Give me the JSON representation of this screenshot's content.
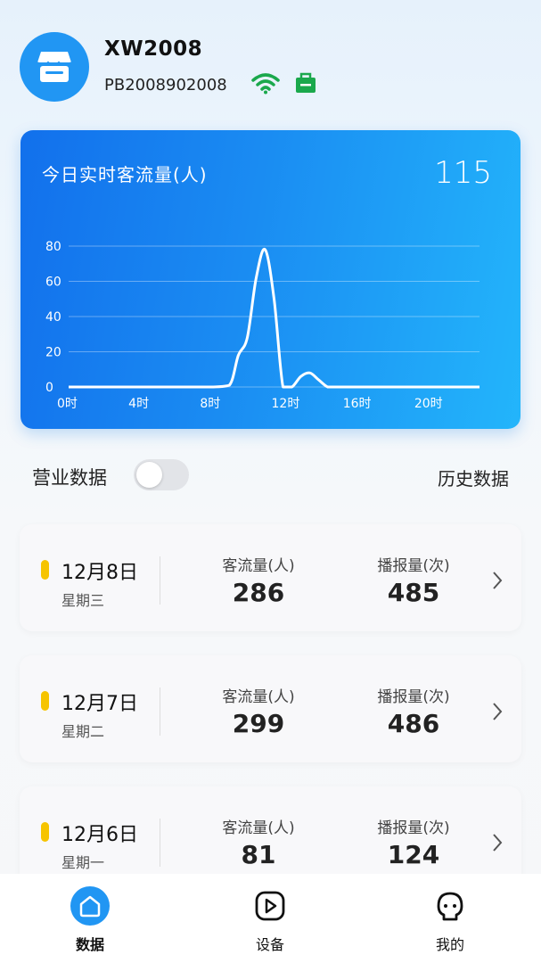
{
  "device": {
    "name": "XW2008",
    "id": "PB2008902008",
    "icons": {
      "avatar": "store-icon",
      "wifi": "wifi-icon",
      "status": "bag-icon"
    },
    "colors": {
      "wifi": "#1aa84c",
      "status": "#1aa84c",
      "avatar": "#2196f3"
    }
  },
  "realtime": {
    "title": "今日实时客流量(人)",
    "total": "115"
  },
  "chart_data": {
    "type": "line",
    "xlabel": "",
    "ylabel": "",
    "ylim": [
      0,
      80
    ],
    "xlim": [
      0,
      23
    ],
    "y_ticks": [
      "0",
      "20",
      "40",
      "60",
      "80"
    ],
    "x_ticks": [
      {
        "x": 0,
        "label": "0时"
      },
      {
        "x": 4,
        "label": "4时"
      },
      {
        "x": 8,
        "label": "8时"
      },
      {
        "x": 12,
        "label": "12时"
      },
      {
        "x": 16,
        "label": "16时"
      },
      {
        "x": 20,
        "label": "20时"
      }
    ],
    "grid": true,
    "series": [
      {
        "x": [
          0,
          1,
          2,
          3,
          4,
          5,
          6,
          7,
          8,
          9,
          9.5,
          10,
          10.5,
          11,
          11.5,
          12,
          12.5,
          13,
          13.5,
          14,
          14.5,
          15,
          16,
          17,
          18,
          19,
          20,
          21,
          22,
          23
        ],
        "values": [
          0,
          0,
          0,
          0,
          0,
          0,
          0,
          0,
          0,
          1,
          18,
          28,
          62,
          78,
          50,
          0,
          0,
          6,
          8,
          4,
          0,
          0,
          0,
          0,
          0,
          0,
          0,
          0,
          0,
          0
        ]
      }
    ]
  },
  "business": {
    "label": "营业数据",
    "toggle_on": false,
    "history": "历史数据"
  },
  "columns": {
    "flow": "客流量(人)",
    "broadcast": "播报量(次)"
  },
  "days": [
    {
      "date": "12月8日",
      "weekday": "星期三",
      "flow": "286",
      "broadcast": "485"
    },
    {
      "date": "12月7日",
      "weekday": "星期二",
      "flow": "299",
      "broadcast": "486"
    },
    {
      "date": "12月6日",
      "weekday": "星期一",
      "flow": "81",
      "broadcast": "124"
    }
  ],
  "nav": [
    {
      "label": "数据",
      "icon": "home-icon",
      "active": true
    },
    {
      "label": "设备",
      "icon": "play-icon",
      "active": false
    },
    {
      "label": "我的",
      "icon": "face-icon",
      "active": false
    }
  ]
}
